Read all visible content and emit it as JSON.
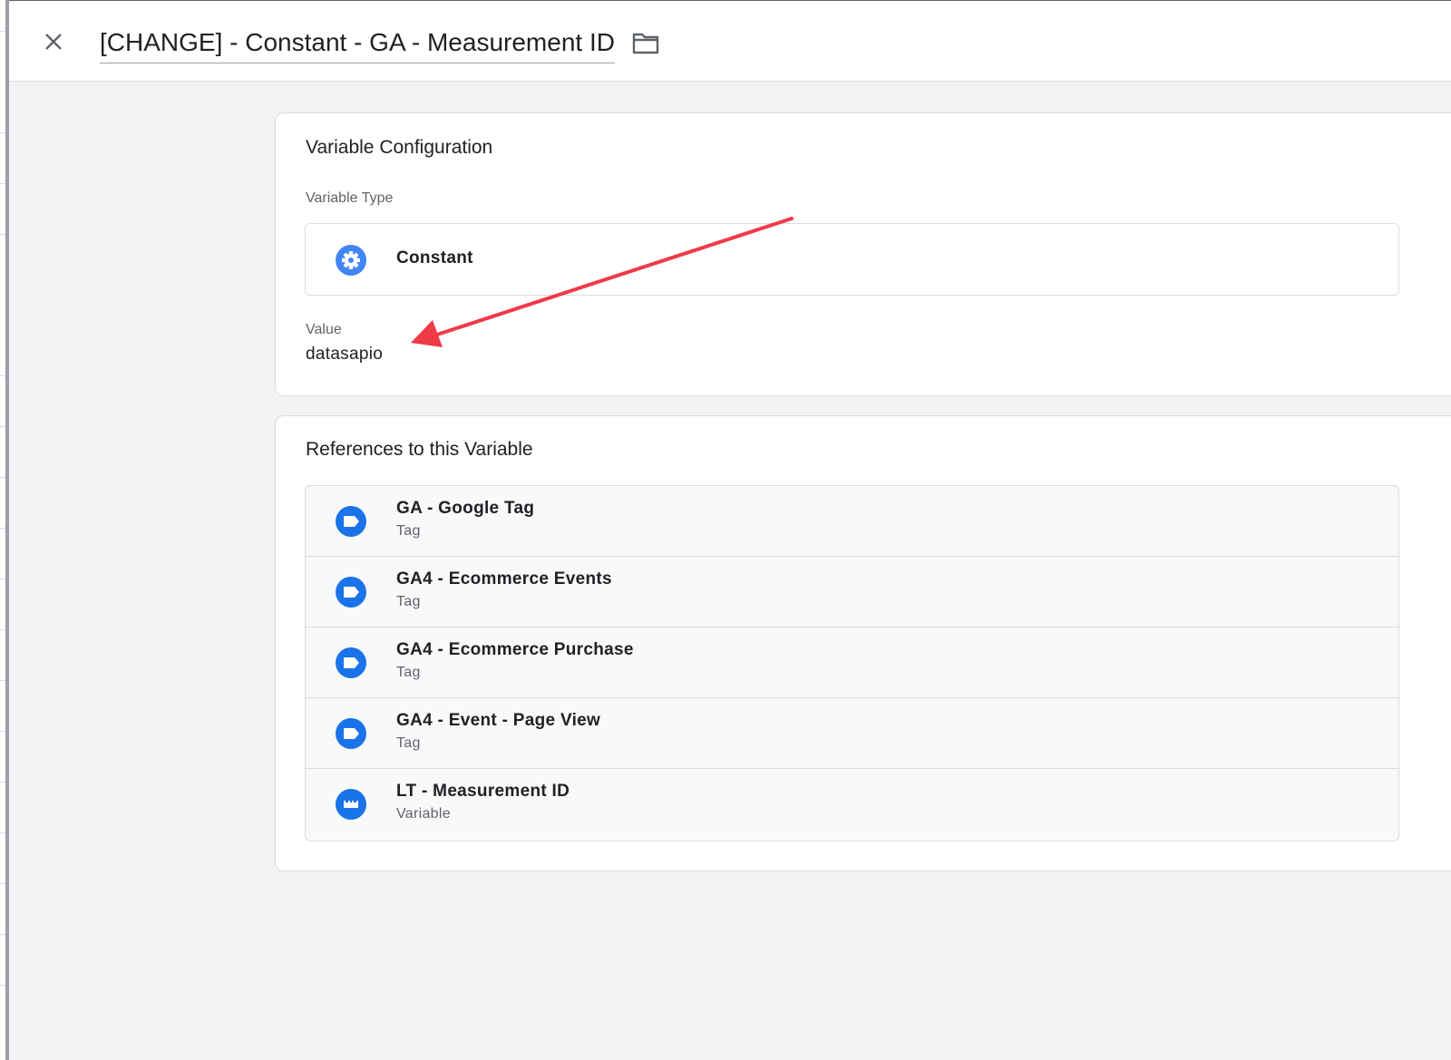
{
  "header": {
    "title": "[CHANGE] - Constant - GA - Measurement ID",
    "close_icon": "close-icon",
    "folder_icon": "folder-icon"
  },
  "config": {
    "card_title": "Variable Configuration",
    "type_label": "Variable Type",
    "type_name": "Constant",
    "type_icon": "gear-icon",
    "value_label": "Value",
    "value": "datasapio"
  },
  "references": {
    "card_title": "References to this Variable",
    "items": [
      {
        "name": "GA - Google Tag",
        "type": "Tag",
        "icon": "tag-icon"
      },
      {
        "name": "GA4 - Ecommerce Events",
        "type": "Tag",
        "icon": "tag-icon"
      },
      {
        "name": "GA4 - Ecommerce Purchase",
        "type": "Tag",
        "icon": "tag-icon"
      },
      {
        "name": "GA4 - Event - Page View",
        "type": "Tag",
        "icon": "tag-icon"
      },
      {
        "name": "LT - Measurement ID",
        "type": "Variable",
        "icon": "variable-icon"
      }
    ]
  },
  "colors": {
    "accent": "#1a73e8",
    "annotation_arrow": "#f03a47"
  }
}
